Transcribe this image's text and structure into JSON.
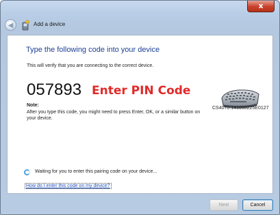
{
  "window": {
    "title": "Add a device",
    "close_label": "x"
  },
  "content": {
    "heading": "Type the following code into your device",
    "subtext": "This will verify that you are connecting to the correct device.",
    "pin_code": "057893",
    "annotation": "Enter PIN Code",
    "note_label": "Note:",
    "note_text": "After you type this code, you might need to press Enter, OK, or a similar button on your device.",
    "device_name": "CS4070:141055225E0127",
    "waiting_text": "Waiting for you to enter this pairing code on your device...",
    "help_link": "How do I enter this code on my device?"
  },
  "buttons": {
    "next": "Next",
    "cancel": "Cancel"
  },
  "colors": {
    "heading": "#1c3f94",
    "annotation": "#e12a2a",
    "link": "#1f50b8"
  }
}
